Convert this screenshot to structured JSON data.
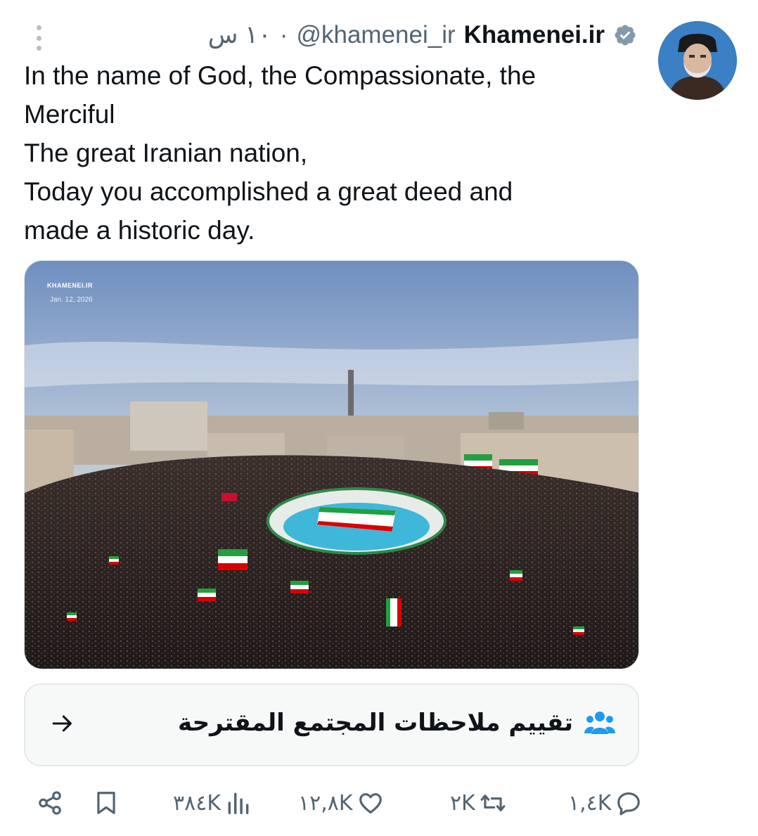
{
  "tweet": {
    "author_name": "Khamenei.ir",
    "handle": "@khamenei_ir",
    "separator": "·",
    "time": "١٠ س",
    "text_lines": [
      "In the name of God, the Compassionate, the",
      "Merciful",
      "The great Iranian nation,",
      "Today you accomplished a great deed and",
      "made a historic day."
    ],
    "media": {
      "watermark": "KHAMENEI.IR",
      "date": "Jan. 12, 2026"
    }
  },
  "community_notes": {
    "label": "تقييم ملاحظات المجتمع المقترحة"
  },
  "actions": {
    "replies": "١,٤K",
    "retweets": "٢K",
    "likes": "١٢,٨K",
    "views": "٣٨٤K"
  },
  "icons": [
    "more-vertical-icon",
    "verified-badge-icon",
    "people-icon",
    "arrow-right-icon",
    "reply-icon",
    "retweet-icon",
    "like-icon",
    "views-icon",
    "bookmark-icon",
    "share-icon"
  ],
  "colors": {
    "text": "#0f1419",
    "secondary": "#536471",
    "verified": "#829aab",
    "people_icon": "#1d9bf0"
  }
}
